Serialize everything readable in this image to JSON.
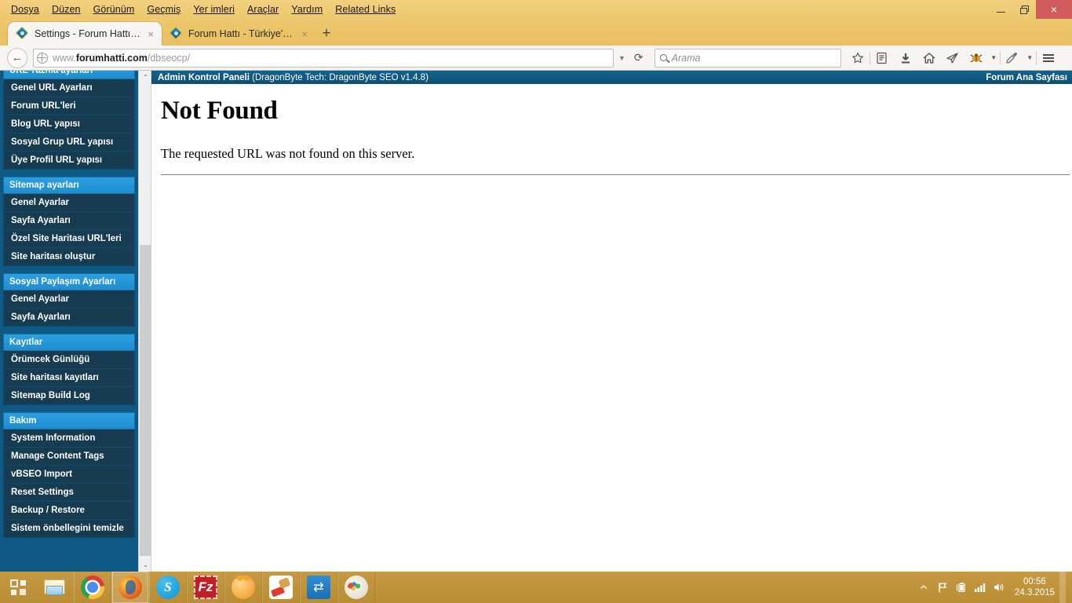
{
  "window": {
    "menu": [
      "Dosya",
      "Düzen",
      "Görünüm",
      "Geçmiş",
      "Yer imleri",
      "Araçlar",
      "Yardım",
      "Related Links"
    ],
    "controls": {
      "minimize": "minimize",
      "maximize": "maximize",
      "close": "×"
    }
  },
  "tabs": [
    {
      "title": "Settings - Forum Hattı - Tü...",
      "close": "×",
      "active": true
    },
    {
      "title": "Forum Hattı - Türkiye'nin E...",
      "close": "×",
      "active": false
    }
  ],
  "newtab_label": "+",
  "navbar": {
    "back_glyph": "←",
    "url_prefix": "www.",
    "url_domain": "forumhatti.com",
    "url_path": "/dbseocp/",
    "url_full": "www.forumhatti.com/dbseocp/",
    "dropdown_glyph": "▼",
    "reload_glyph": "⟳",
    "search_placeholder": "Arama",
    "search_value": "",
    "icons": [
      "bookmark-star-icon",
      "reader-icon",
      "downloads-icon",
      "home-icon",
      "send-tab-icon",
      "addon-icon",
      "eyedropper-icon",
      "menu-hamburger-icon"
    ]
  },
  "sidebar": {
    "groups": [
      {
        "heading": "URL Yazma ayarları",
        "items": [
          "Genel URL Ayarları",
          "Forum URL'leri",
          "Blog URL yapısı",
          "Sosyal Grup URL yapısı",
          "Üye Profil URL yapısı"
        ]
      },
      {
        "heading": "Sitemap ayarları",
        "items": [
          "Genel Ayarlar",
          "Sayfa Ayarları",
          "Özel Site Haritası URL'leri",
          "Site haritası oluştur"
        ]
      },
      {
        "heading": "Sosyal Paylaşım Ayarları",
        "items": [
          "Genel Ayarlar",
          "Sayfa Ayarları"
        ]
      },
      {
        "heading": "Kayıtlar",
        "items": [
          "Örümcek Günlüğü",
          "Site haritası kayıtları",
          "Sitemap Build Log"
        ]
      },
      {
        "heading": "Bakım",
        "items": [
          "System Information",
          "Manage Content Tags",
          "vBSEO Import",
          "Reset Settings",
          "Backup / Restore",
          "Sistem önbellegini temizle"
        ]
      }
    ]
  },
  "scrollbar": {
    "up_glyph": "⌃",
    "down_glyph": "⌄"
  },
  "admin_bar": {
    "title": "Admin Kontrol Paneli",
    "subtitle": " (DragonByte Tech: DragonByte SEO v1.4.8)",
    "home_link": "Forum Ana Sayfası"
  },
  "page": {
    "heading": "Not Found",
    "body": "The requested URL was not found on this server."
  },
  "taskbar": {
    "start": "start-button",
    "apps": [
      {
        "name": "file-explorer",
        "icon": "explorer"
      },
      {
        "name": "google-chrome",
        "icon": "chrome"
      },
      {
        "name": "mozilla-firefox",
        "icon": "firefox",
        "running": true
      },
      {
        "name": "skype",
        "icon": "skype",
        "glyph": "S"
      },
      {
        "name": "filezilla",
        "icon": "filezilla",
        "glyph": "Fz"
      },
      {
        "name": "gnome-app",
        "icon": "gnome"
      },
      {
        "name": "ccleaner",
        "icon": "ccleaner"
      },
      {
        "name": "teamviewer",
        "icon": "teamviewer"
      },
      {
        "name": "paint",
        "icon": "paint"
      }
    ],
    "tray": [
      "show-hidden-icons",
      "action-center-flag",
      "battery",
      "network-signal",
      "volume"
    ],
    "clock_time": "00:56",
    "clock_date": "24.3.2015"
  },
  "colors": {
    "window_chrome": "#eec86f",
    "sidebar_bg": "#0e5a85",
    "nav_heading": "#1e8ed0",
    "nav_item": "#173c52",
    "admin_bar": "#0d4f74",
    "taskbar": "#b98d34",
    "close_button": "#cf5b5b"
  }
}
